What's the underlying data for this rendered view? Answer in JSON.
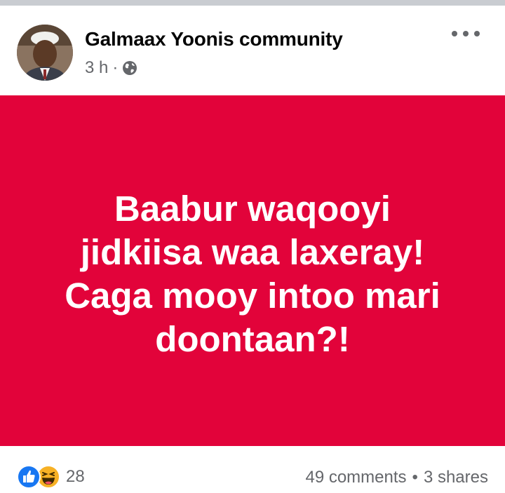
{
  "post": {
    "author": "Galmaax Yoonis community",
    "time": "3 h",
    "separator": "·",
    "privacy_icon": "globe-icon",
    "body_lines": [
      "Baabur waqooyi",
      "jidkiisa waa laxeray!",
      "Caga mooy intoo mari",
      "doontaan?!"
    ],
    "background_color": "#e2033a"
  },
  "footer": {
    "reaction_icons": [
      "like-icon",
      "haha-icon"
    ],
    "reaction_count": "28",
    "comments": "49 comments",
    "separator": "•",
    "shares": "3 shares"
  }
}
